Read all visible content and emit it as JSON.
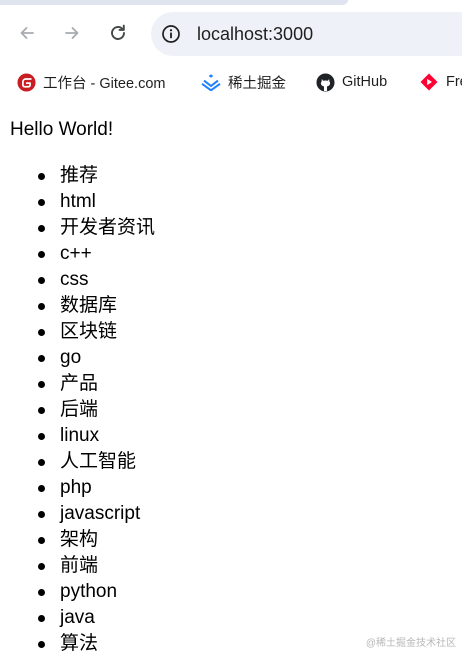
{
  "browser": {
    "url": "localhost:3000",
    "icons": {
      "back": "arrow-left-icon",
      "forward": "arrow-right-icon",
      "reload": "reload-icon",
      "site_info": "info-circle-icon"
    }
  },
  "bookmarks": [
    {
      "label": "工作台 - Gitee.com",
      "icon": "gitee-logo-icon",
      "color": "#c71d23"
    },
    {
      "label": "稀土掘金",
      "icon": "juejin-logo-icon",
      "color": "#1e80ff"
    },
    {
      "label": "GitHub",
      "icon": "github-logo-icon",
      "color": "#1f2328"
    },
    {
      "label": "Fre",
      "icon": "youtube-logo-icon",
      "color": "#ff0033"
    }
  ],
  "page": {
    "heading": "Hello World!",
    "topics": [
      "推荐",
      "html",
      "开发者资讯",
      "c++",
      "css",
      "数据库",
      "区块链",
      "go",
      "产品",
      "后端",
      "linux",
      "人工智能",
      "php",
      "javascript",
      "架构",
      "前端",
      "python",
      "java",
      "算法"
    ]
  },
  "watermark": "@稀土掘金技术社区"
}
